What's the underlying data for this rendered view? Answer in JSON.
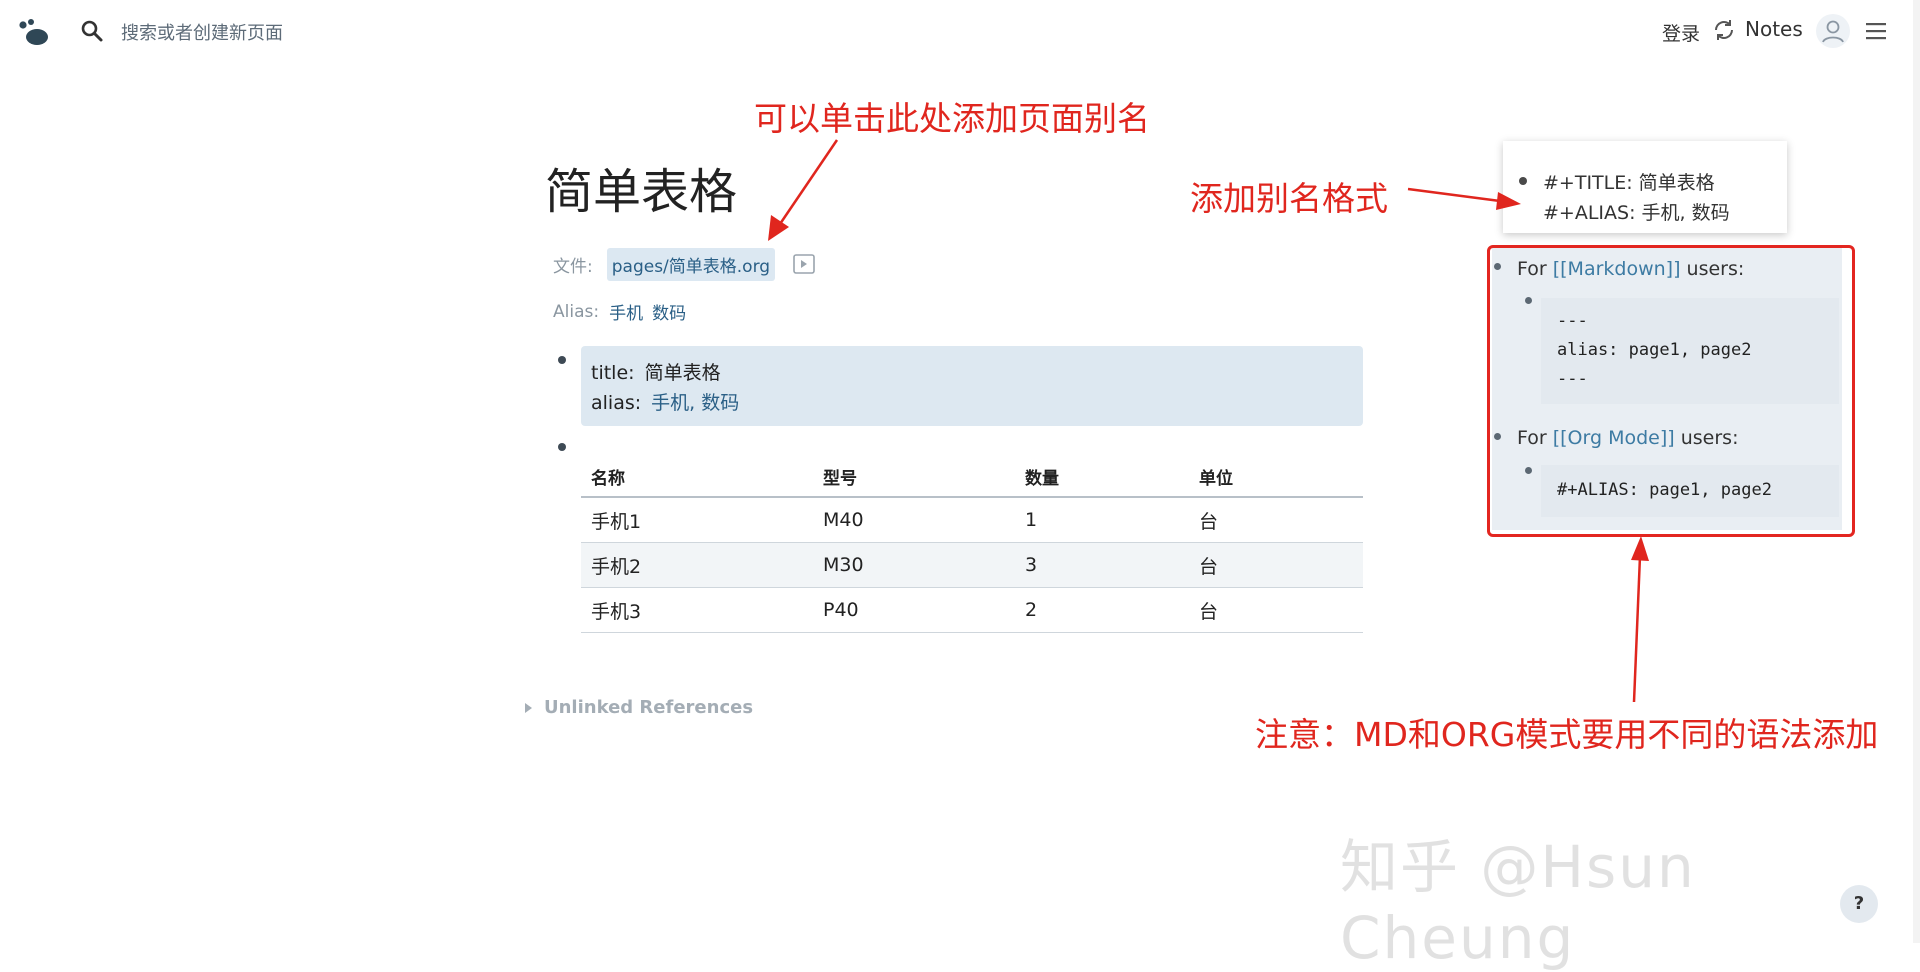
{
  "topbar": {
    "search_placeholder": "搜索或者创建新页面",
    "login": "登录",
    "notes": "Notes"
  },
  "page": {
    "title": "简单表格",
    "file_label": "文件:",
    "file_path": "pages/简单表格.org",
    "alias_label": "Alias:",
    "aliases": [
      "手机",
      "数码"
    ],
    "props": {
      "title_key": "title:",
      "title_value": "简单表格",
      "alias_key": "alias:",
      "alias_value": "手机, 数码"
    },
    "table": {
      "headers": [
        "名称",
        "型号",
        "数量",
        "单位"
      ],
      "rows": [
        [
          "手机1",
          "M40",
          "1",
          "台"
        ],
        [
          "手机2",
          "M30",
          "3",
          "台"
        ],
        [
          "手机3",
          "P40",
          "2",
          "台"
        ]
      ]
    },
    "unlinked_references": "Unlinked References"
  },
  "annotations": {
    "top": "可以单击此处添加页面别名",
    "alias_format": "添加别名格式",
    "note": "注意：MD和ORG模式要用不同的语法添加",
    "color": "#e0261e"
  },
  "popup_editing": {
    "line1": "#+TITLE: 简单表格",
    "line2": "#+ALIAS: 手机, 数码"
  },
  "popup_docs": {
    "md_prefix": "For ",
    "md_link": "[[Markdown]]",
    "md_suffix": " users:",
    "md_code": [
      "---",
      "alias: page1, page2",
      "---"
    ],
    "org_prefix": "For ",
    "org_link": "[[Org Mode]]",
    "org_suffix": " users:",
    "org_code": "#+ALIAS: page1, page2"
  },
  "watermark": "知乎 @Hsun Cheung",
  "help": "?"
}
